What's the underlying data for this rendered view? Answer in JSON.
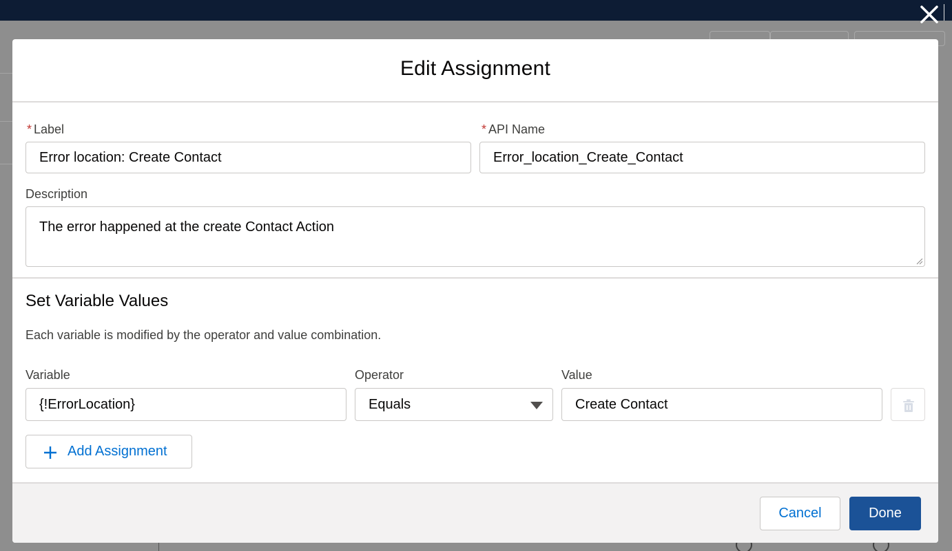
{
  "modal": {
    "title": "Edit Assignment"
  },
  "fields": {
    "label": {
      "required_marker": "*",
      "label": "Label",
      "value": "Error location: Create Contact"
    },
    "api_name": {
      "required_marker": "*",
      "label": "API Name",
      "value": "Error_location_Create_Contact"
    },
    "description": {
      "label": "Description",
      "value": "The error happened at the create Contact Action"
    }
  },
  "assignments_section": {
    "title": "Set Variable Values",
    "help_text": "Each variable is modified by the operator and value combination.",
    "column_headers": {
      "variable": "Variable",
      "operator": "Operator",
      "value": "Value"
    },
    "rows": [
      {
        "variable": "{!ErrorLocation}",
        "operator": "Equals",
        "value": "Create Contact",
        "delete_icon": "trash-icon"
      }
    ],
    "add_button": {
      "icon": "plus-icon",
      "label": "Add Assignment"
    }
  },
  "footer": {
    "cancel_label": "Cancel",
    "done_label": "Done"
  },
  "icons": {
    "close": "close-icon",
    "dropdown": "chevron-down-icon",
    "resize": "resize-handle-icon"
  },
  "colors": {
    "brand": "#1b5297",
    "link": "#0070d2",
    "required": "#c23934",
    "header_bar": "#0d1c34",
    "overlay": "#8e8e8e"
  }
}
